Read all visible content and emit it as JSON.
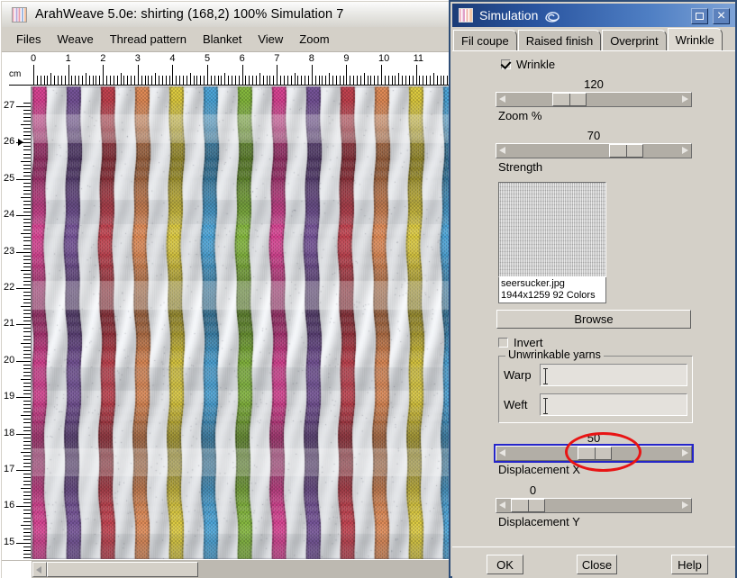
{
  "main_window": {
    "title": "ArahWeave 5.0e: shirting (168,2) 100% Simulation 7",
    "icon": "fabric-stripes-icon",
    "menu": [
      {
        "label": "Files"
      },
      {
        "label": "Weave"
      },
      {
        "label": "Thread pattern"
      },
      {
        "label": "Blanket"
      },
      {
        "label": "View"
      },
      {
        "label": "Zoom"
      }
    ],
    "ruler": {
      "unit_label": "cm",
      "horizontal_ticks": [
        "0",
        "1",
        "2",
        "3",
        "4",
        "5",
        "6",
        "7",
        "8",
        "9",
        "10",
        "11"
      ],
      "vertical_ticks": [
        "27",
        "26",
        "25",
        "24",
        "23",
        "22",
        "21",
        "20",
        "19",
        "18",
        "17",
        "16",
        "15"
      ],
      "marker_at": "26"
    },
    "fabric": {
      "description": "woven shirting simulation with vertical colour stripes",
      "stripe_colors": [
        "#e8459c",
        "#7b56a0",
        "#cf4452",
        "#f0935a",
        "#ecd841",
        "#4fb0e8",
        "#8cc43f"
      ],
      "ground_color": "#f2f4f6"
    },
    "scrollbar": {
      "orientation": "horizontal"
    }
  },
  "sim_dialog": {
    "title": "Simulation",
    "title_icon": "fabric-stripes-icon",
    "swirl_icon": "swirl-icon",
    "buttons": {
      "maximize": "maximize-icon",
      "close": "close-icon"
    },
    "tabs": [
      {
        "label": "Fil coupe",
        "selected": false
      },
      {
        "label": "Raised finish",
        "selected": false
      },
      {
        "label": "Overprint",
        "selected": false
      },
      {
        "label": "Wrinkle",
        "selected": true
      }
    ],
    "wrinkle_checkbox": {
      "label": "Wrinkle",
      "checked": true
    },
    "sliders": [
      {
        "name": "zoom",
        "value": "120",
        "label": "Zoom %",
        "thumb_pct": 32,
        "focused": false
      },
      {
        "name": "strength",
        "value": "70",
        "label": "Strength",
        "thumb_pct": 70,
        "focused": false
      },
      {
        "name": "displacement_x",
        "value": "50",
        "label": "Displacement X",
        "thumb_pct": 50,
        "focused": true
      },
      {
        "name": "displacement_y",
        "value": "0",
        "label": "Displacement Y",
        "thumb_pct": 3,
        "focused": false
      }
    ],
    "preview": {
      "filename": "seersucker.jpg",
      "details": "1944x1259  92 Colors"
    },
    "browse_label": "Browse",
    "invert_checkbox": {
      "label": "Invert",
      "checked": false
    },
    "group": {
      "legend": "Unwrinkable yarns",
      "fields": [
        {
          "label": "Warp",
          "value": "",
          "placeholder": ""
        },
        {
          "label": "Weft",
          "value": "",
          "placeholder": ""
        }
      ]
    },
    "annotation": {
      "shape": "red-ellipse",
      "color": "#e81414",
      "targets": "displacement-x-slider"
    },
    "footer": {
      "ok": "OK",
      "close": "Close",
      "help": "Help"
    }
  }
}
